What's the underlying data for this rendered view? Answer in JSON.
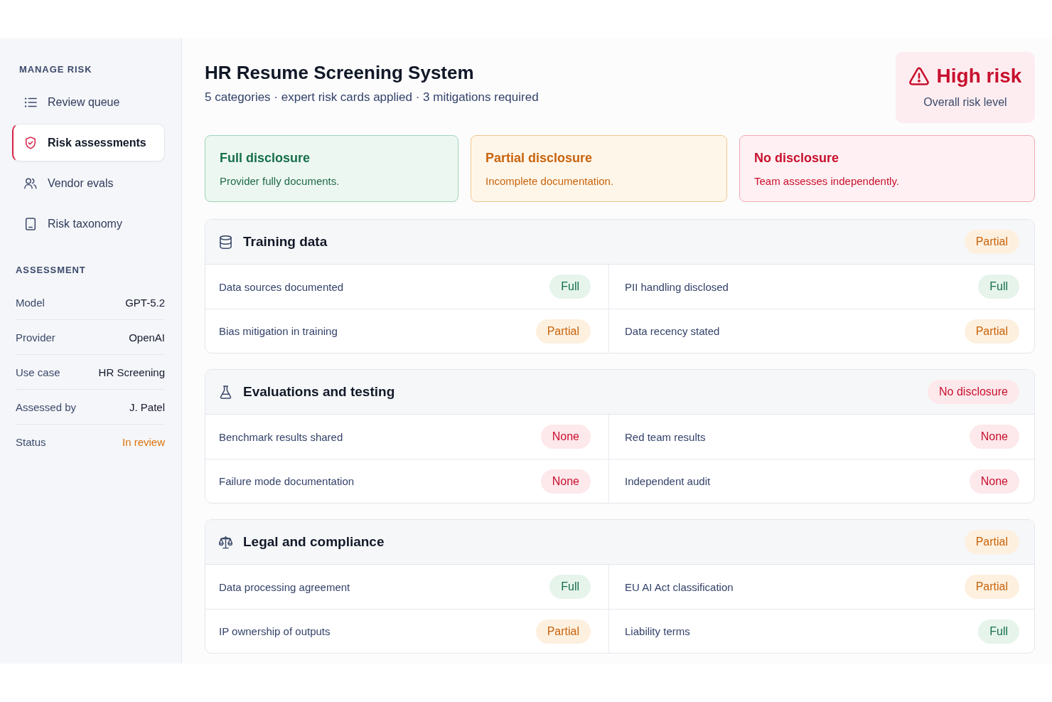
{
  "sidebar": {
    "nav_heading": "MANAGE RISK",
    "nav_items": [
      {
        "label": "Review queue",
        "selected": false
      },
      {
        "label": "Risk assessments",
        "selected": true
      },
      {
        "label": "Vendor evals",
        "selected": false
      },
      {
        "label": "Risk taxonomy",
        "selected": false
      }
    ],
    "details_heading": "ASSESSMENT",
    "details": [
      {
        "label": "Model",
        "value": "GPT-5.2",
        "kind": "text"
      },
      {
        "label": "Provider",
        "value": "OpenAI",
        "kind": "text"
      },
      {
        "label": "Use case",
        "value": "HR Screening",
        "kind": "text"
      },
      {
        "label": "Assessed by",
        "value": "J. Patel",
        "kind": "text"
      },
      {
        "label": "Status",
        "value": "In review",
        "kind": "status"
      }
    ]
  },
  "header": {
    "title": "HR Resume Screening System",
    "subtitle": "5 categories · expert risk cards applied · 3 mitigations required",
    "risk": {
      "label": "High risk",
      "caption": "Overall risk level",
      "kind": "high"
    }
  },
  "legend": [
    {
      "title": "Full disclosure",
      "text": "Provider fully documents.",
      "kind": "full"
    },
    {
      "title": "Partial disclosure",
      "text": "Incomplete documentation.",
      "kind": "partial"
    },
    {
      "title": "No disclosure",
      "text": "Team assesses independently.",
      "kind": "none"
    }
  ],
  "categories": [
    {
      "title": "Training data",
      "status": {
        "label": "Partial",
        "kind": "partial"
      },
      "items": [
        {
          "label": "Data sources documented",
          "status": {
            "label": "Full",
            "kind": "full"
          }
        },
        {
          "label": "PII handling disclosed",
          "status": {
            "label": "Full",
            "kind": "full"
          }
        },
        {
          "label": "Bias mitigation in training",
          "status": {
            "label": "Partial",
            "kind": "partial"
          }
        },
        {
          "label": "Data recency stated",
          "status": {
            "label": "Partial",
            "kind": "partial"
          }
        }
      ]
    },
    {
      "title": "Evaluations and testing",
      "status": {
        "label": "No disclosure",
        "kind": "none"
      },
      "items": [
        {
          "label": "Benchmark results shared",
          "status": {
            "label": "None",
            "kind": "none"
          }
        },
        {
          "label": "Red team results",
          "status": {
            "label": "None",
            "kind": "none"
          }
        },
        {
          "label": "Failure mode documentation",
          "status": {
            "label": "None",
            "kind": "none"
          }
        },
        {
          "label": "Independent audit",
          "status": {
            "label": "None",
            "kind": "none"
          }
        }
      ]
    },
    {
      "title": "Legal and compliance",
      "status": {
        "label": "Partial",
        "kind": "partial"
      },
      "items": [
        {
          "label": "Data processing agreement",
          "status": {
            "label": "Full",
            "kind": "full"
          }
        },
        {
          "label": "EU AI Act classification",
          "status": {
            "label": "Partial",
            "kind": "partial"
          }
        },
        {
          "label": "IP ownership of outputs",
          "status": {
            "label": "Partial",
            "kind": "partial"
          }
        },
        {
          "label": "Liability terms",
          "status": {
            "label": "Full",
            "kind": "full"
          }
        }
      ]
    }
  ]
}
